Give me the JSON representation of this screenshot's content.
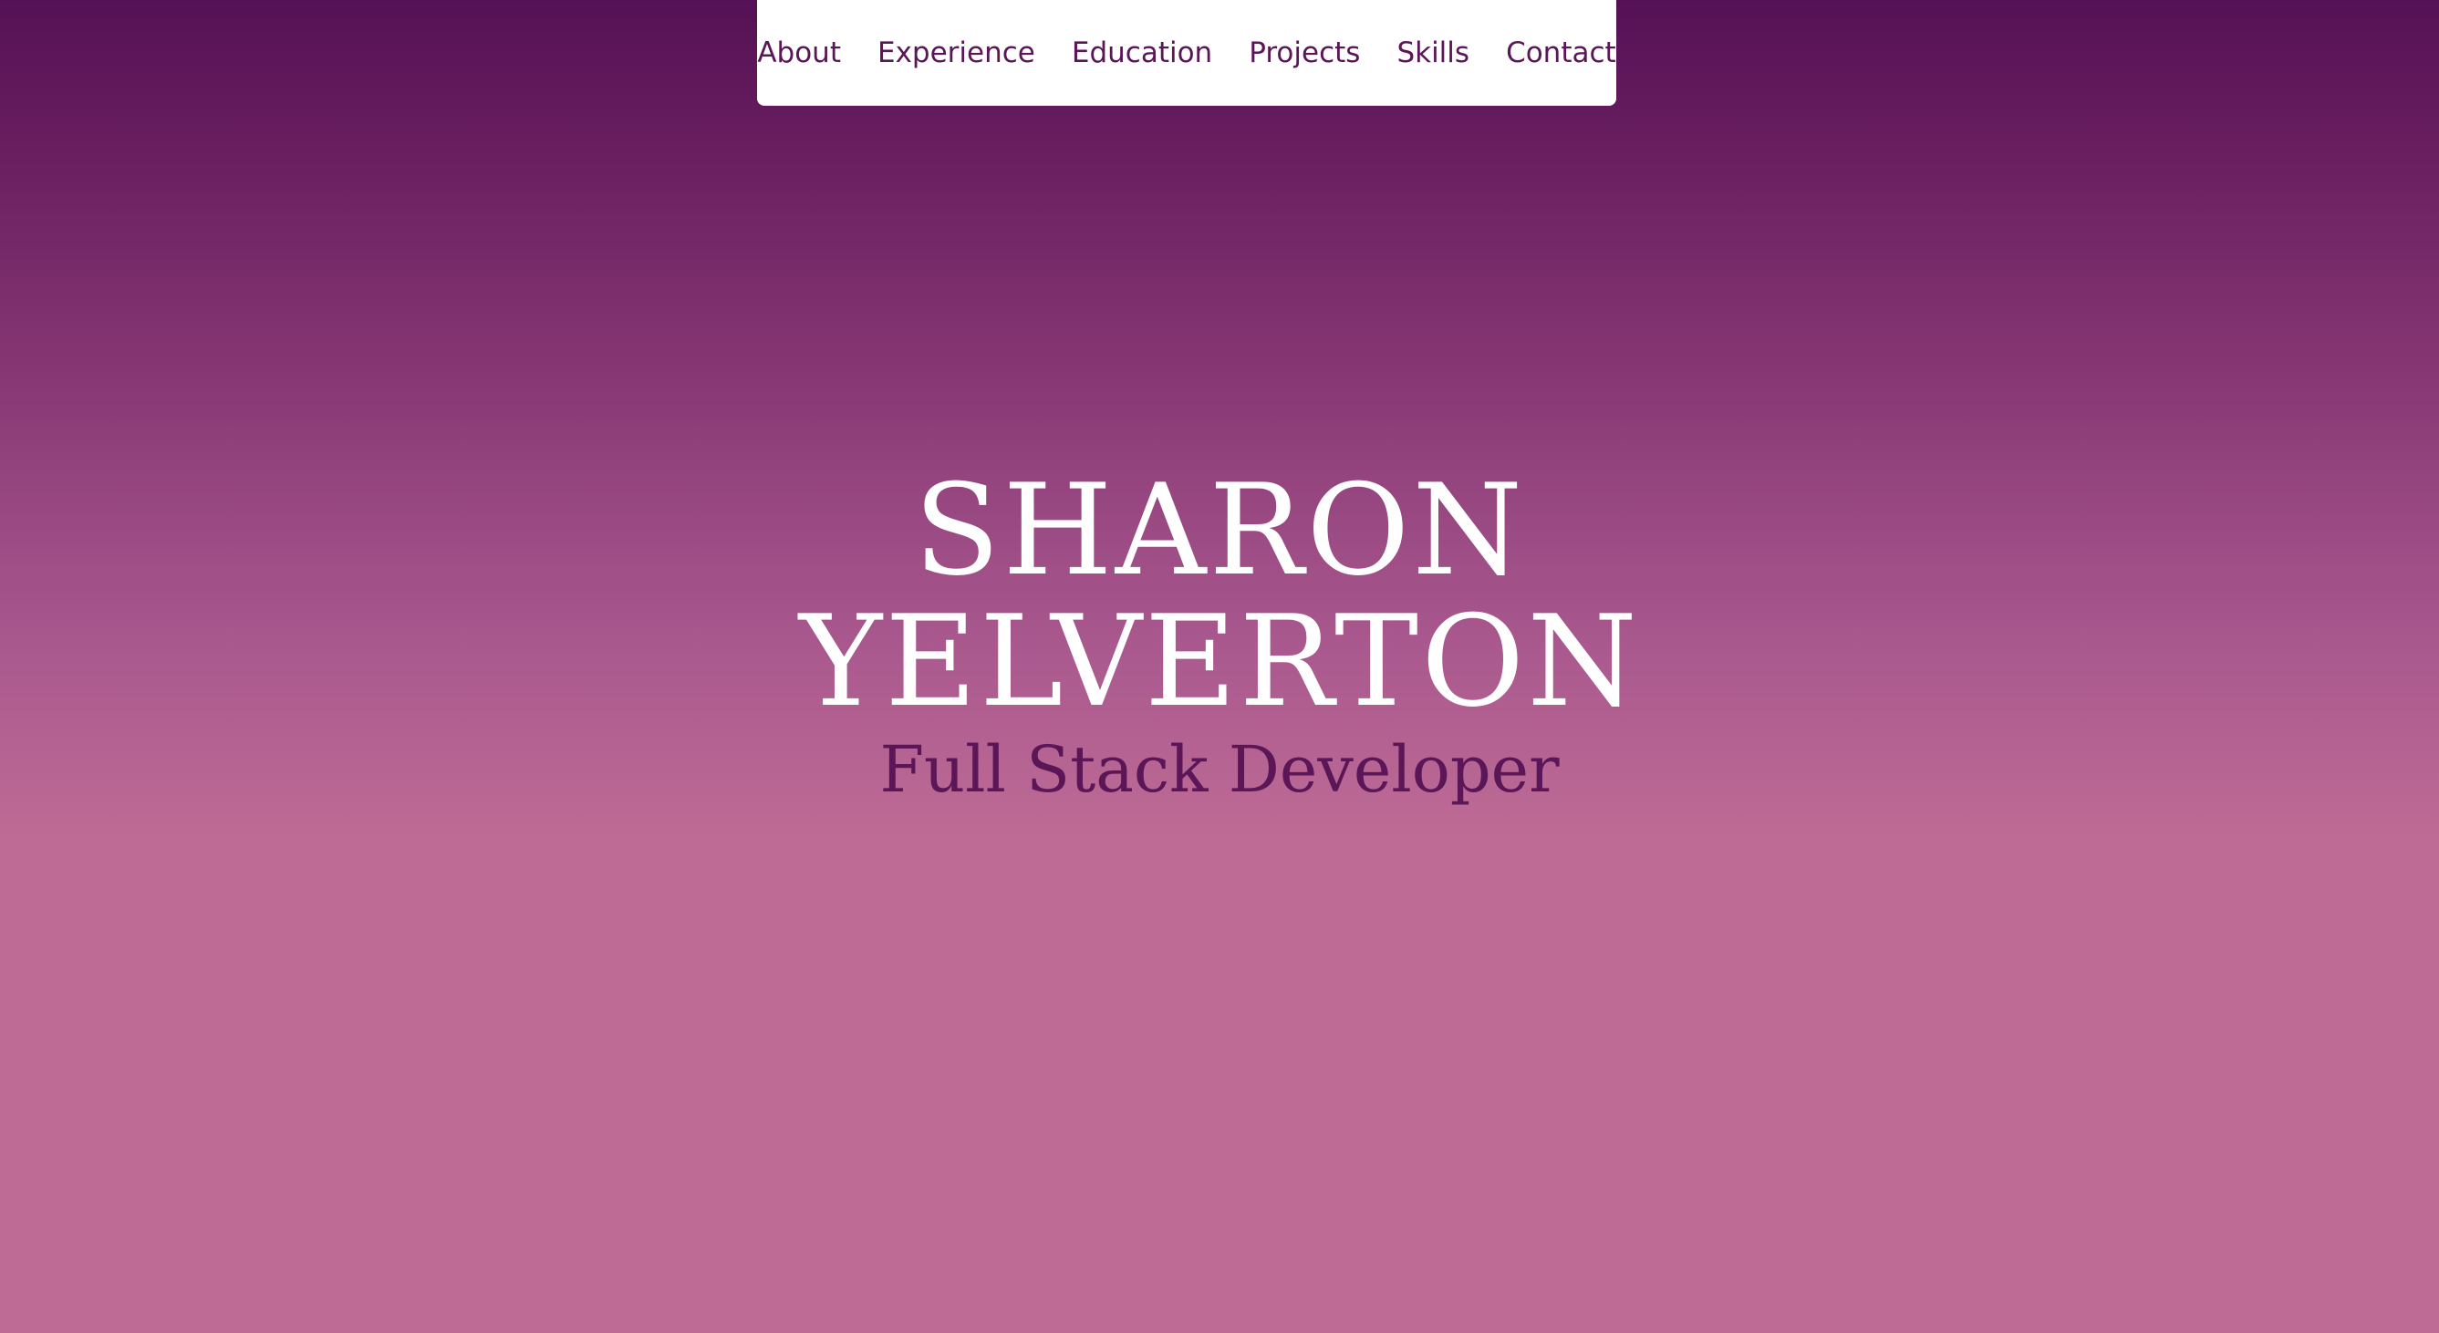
{
  "nav": {
    "items": [
      {
        "label": "About"
      },
      {
        "label": "Experience"
      },
      {
        "label": "Education"
      },
      {
        "label": "Projects"
      },
      {
        "label": "Skills"
      },
      {
        "label": "Contact"
      }
    ]
  },
  "hero": {
    "name_line1": "SHARON",
    "name_line2": "YELVERTON",
    "subtitle": "Full Stack Developer"
  },
  "colors": {
    "accent": "#5a1657",
    "gradient_top": "#551155",
    "gradient_bottom": "#be6b95",
    "nav_background": "#ffffff"
  }
}
